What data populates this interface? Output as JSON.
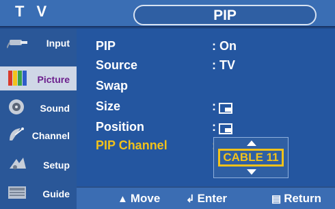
{
  "header": {
    "left_title": "T V",
    "menu_title": "PIP"
  },
  "sidebar": {
    "items": [
      {
        "label": "Input",
        "icon": "input-plug-icon",
        "active": false
      },
      {
        "label": "Picture",
        "icon": "picture-bars-icon",
        "active": true
      },
      {
        "label": "Sound",
        "icon": "speaker-icon",
        "active": false
      },
      {
        "label": "Channel",
        "icon": "satellite-dish-icon",
        "active": false
      },
      {
        "label": "Setup",
        "icon": "gear-setup-icon",
        "active": false
      },
      {
        "label": "Guide",
        "icon": "program-guide-icon",
        "active": false
      }
    ]
  },
  "menu": {
    "rows": [
      {
        "name": "PIP",
        "value": ": On"
      },
      {
        "name": "Source",
        "value": ": TV"
      },
      {
        "name": "Swap",
        "value": ""
      },
      {
        "name": "Size",
        "value": ":"
      },
      {
        "name": "Position",
        "value": ":"
      },
      {
        "name": "PIP Channel",
        "value": ":"
      }
    ],
    "channel_value": "CABLE 11"
  },
  "footer": {
    "move_label": "Move",
    "enter_label": "Enter",
    "return_label": "Return",
    "move_icon": "updown-arrows-icon",
    "enter_icon": "enter-icon",
    "return_icon": "menu-return-icon"
  },
  "colors": {
    "accent": "#f2c21a",
    "background": "#2456a0",
    "active_item": "#cfd7e6"
  }
}
